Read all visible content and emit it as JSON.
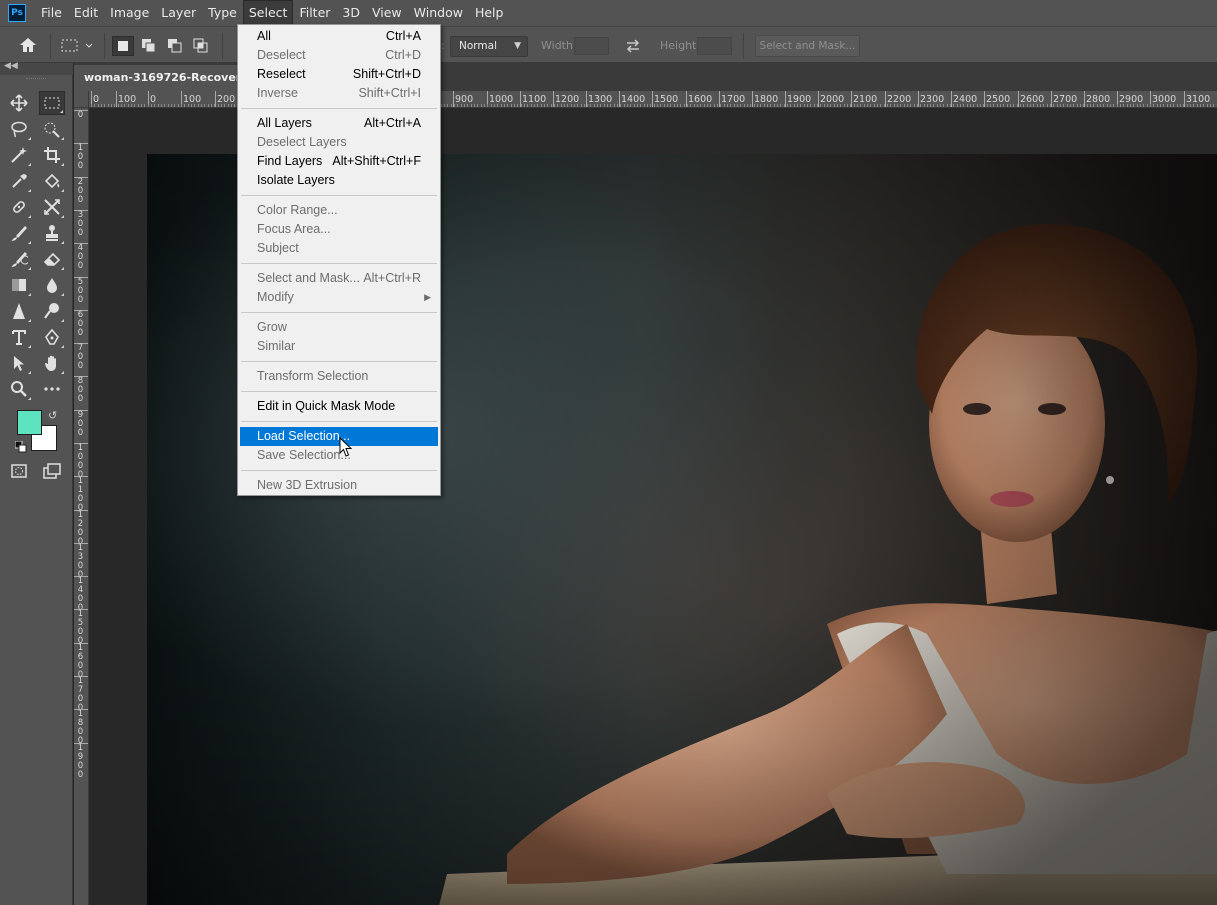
{
  "app": {
    "logo_text": "Ps",
    "menus": [
      "File",
      "Edit",
      "Image",
      "Layer",
      "Type",
      "Select",
      "Filter",
      "3D",
      "View",
      "Window",
      "Help"
    ],
    "active_menu": "Select"
  },
  "options_bar": {
    "style_label": ":",
    "style_value": "Normal",
    "width_label": "Width:",
    "height_label": "Height:",
    "select_and_mask_label": "Select and Mask..."
  },
  "toolbar": {
    "collapse_icon": "double-chevron-left",
    "tools": [
      {
        "name": "move-tool",
        "icon": "move-icon"
      },
      {
        "name": "rect-marquee-tool",
        "icon": "rect-marquee-icon",
        "selected": true
      },
      {
        "name": "lasso-tool",
        "icon": "lasso-icon"
      },
      {
        "name": "quick-selection-tool",
        "icon": "quick-selection-icon"
      },
      {
        "name": "magic-wand-tool",
        "icon": "magic-wand-icon"
      },
      {
        "name": "crop-tool",
        "icon": "crop-icon"
      },
      {
        "name": "eyedropper-tool",
        "icon": "eyedropper-icon"
      },
      {
        "name": "paint-bucket-tool",
        "icon": "paint-bucket-icon"
      },
      {
        "name": "spot-healing-tool",
        "icon": "healing-icon"
      },
      {
        "name": "content-aware-move-tool",
        "icon": "content-aware-move-icon"
      },
      {
        "name": "brush-tool",
        "icon": "brush-icon"
      },
      {
        "name": "clone-stamp-tool",
        "icon": "stamp-icon"
      },
      {
        "name": "history-brush-tool",
        "icon": "history-brush-icon"
      },
      {
        "name": "eraser-tool",
        "icon": "eraser-icon"
      },
      {
        "name": "gradient-tool",
        "icon": "gradient-icon"
      },
      {
        "name": "blur-tool",
        "icon": "blur-drop-icon"
      },
      {
        "name": "sharpen-tool",
        "icon": "sharpen-icon"
      },
      {
        "name": "dodge-tool",
        "icon": "dodge-icon"
      },
      {
        "name": "type-tool",
        "icon": "type-icon"
      },
      {
        "name": "pen-tool",
        "icon": "pen-icon"
      },
      {
        "name": "path-selection-tool",
        "icon": "path-selection-icon"
      },
      {
        "name": "hand-tool",
        "icon": "hand-icon"
      },
      {
        "name": "zoom-tool",
        "icon": "zoom-icon"
      },
      {
        "name": "edit-toolbar",
        "icon": "more-icon"
      },
      {
        "name": "quick-mask-mode",
        "icon": "quick-mask-icon"
      },
      {
        "name": "screen-mode",
        "icon": "screen-mode-icon"
      }
    ],
    "foreground_color": "#5ee3c1",
    "background_color": "#ffffff"
  },
  "document": {
    "tab_title": "woman-3169726-Recovered.jp"
  },
  "rulers": {
    "top_labels": [
      "0",
      "100",
      "0",
      "100",
      "200",
      "900",
      "1000",
      "1100",
      "1200",
      "1300",
      "1400",
      "1500",
      "1600",
      "1700",
      "1800",
      "1900",
      "2000",
      "2100",
      "2200",
      "2300",
      "2400",
      "2500",
      "2600",
      "2700",
      "2800",
      "2900",
      "3000",
      "3100"
    ],
    "left_labels": [
      "0",
      "1\n0\n0",
      "2\n0\n0",
      "3\n0\n0",
      "4\n0\n0",
      "5\n0\n0",
      "6\n0\n0",
      "7\n0\n0",
      "8\n0\n0",
      "9\n0\n0",
      "1\n0\n0\n0",
      "1\n1\n0\n0",
      "1\n2\n0\n0",
      "1\n3\n0\n0",
      "1\n4\n0\n0",
      "1\n5\n0\n0",
      "1\n6\n0\n0",
      "1\n7\n0\n0",
      "1\n8\n0\n0",
      "1\n9\n0\n0"
    ]
  },
  "select_menu": {
    "items": [
      {
        "label": "All",
        "shortcut": "Ctrl+A",
        "enabled": true
      },
      {
        "label": "Deselect",
        "shortcut": "Ctrl+D",
        "enabled": false
      },
      {
        "label": "Reselect",
        "shortcut": "Shift+Ctrl+D",
        "enabled": true
      },
      {
        "label": "Inverse",
        "shortcut": "Shift+Ctrl+I",
        "enabled": false
      },
      {
        "separator": true
      },
      {
        "label": "All Layers",
        "shortcut": "Alt+Ctrl+A",
        "enabled": true
      },
      {
        "label": "Deselect Layers",
        "shortcut": "",
        "enabled": false
      },
      {
        "label": "Find Layers",
        "shortcut": "Alt+Shift+Ctrl+F",
        "enabled": true
      },
      {
        "label": "Isolate Layers",
        "shortcut": "",
        "enabled": true
      },
      {
        "separator": true
      },
      {
        "label": "Color Range...",
        "shortcut": "",
        "enabled": false
      },
      {
        "label": "Focus Area...",
        "shortcut": "",
        "enabled": false
      },
      {
        "label": "Subject",
        "shortcut": "",
        "enabled": false
      },
      {
        "separator": true
      },
      {
        "label": "Select and Mask...",
        "shortcut": "Alt+Ctrl+R",
        "enabled": false
      },
      {
        "label": "Modify",
        "shortcut": "",
        "enabled": false,
        "submenu": true
      },
      {
        "separator": true
      },
      {
        "label": "Grow",
        "shortcut": "",
        "enabled": false
      },
      {
        "label": "Similar",
        "shortcut": "",
        "enabled": false
      },
      {
        "separator": true
      },
      {
        "label": "Transform Selection",
        "shortcut": "",
        "enabled": false
      },
      {
        "separator": true
      },
      {
        "label": "Edit in Quick Mask Mode",
        "shortcut": "",
        "enabled": true
      },
      {
        "separator": true
      },
      {
        "label": "Load Selection...",
        "shortcut": "",
        "enabled": true,
        "highlighted": true
      },
      {
        "label": "Save Selection...",
        "shortcut": "",
        "enabled": false
      },
      {
        "separator": true
      },
      {
        "label": "New 3D Extrusion",
        "shortcut": "",
        "enabled": false
      }
    ],
    "highlight_color": "#0078d7"
  }
}
